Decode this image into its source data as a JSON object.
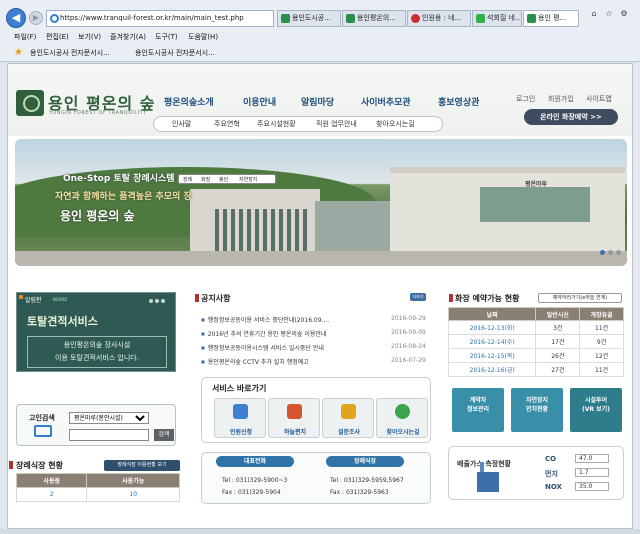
{
  "browser": {
    "address": "https://www.tranquil-forest.or.kr/main/main_test.php",
    "tabs": [
      "용인도시공...",
      "용인평온의...",
      "인원용 : 네...",
      "석회질 네..",
      "용인 평..."
    ],
    "active_tab_index": 4,
    "menu": [
      "파일(F)",
      "편집(E)",
      "보기(V)",
      "즐겨찾기(A)",
      "도구(T)",
      "도움말(H)"
    ],
    "favorites": [
      "용인도시공사 전자문서시...",
      "용인도시공사 전자문서시..."
    ]
  },
  "site": {
    "logo_title": "용인 평온의 숲",
    "logo_sub": "YONGIN FOREST OF TRANQUILITY",
    "nav": [
      "평온의숲소개",
      "이용안내",
      "알림마당",
      "사이버추모관",
      "홍보영상관"
    ],
    "util_links": [
      "로그인",
      "회원가입",
      "사이트맵"
    ],
    "reserve_button": "온라인 화장예약 >>",
    "subnav": [
      "인사말",
      "주요연혁",
      "주요시설현황",
      "직원 업무안내",
      "찾아오시는길"
    ]
  },
  "hero": {
    "line1": "One-Stop 토탈 장례시스템",
    "line2": "자연과 함께하는 품격높은 추모의 장",
    "line3": "용인 평온의 숲",
    "tags": [
      "장례",
      "화장",
      "봉안",
      "자연장지"
    ],
    "building_sign": "평온마루"
  },
  "notice": {
    "title": "알림판",
    "badge": "BOARD",
    "headline": "토탈견적서비스",
    "body_line1": "용인평온의숲 장사시설",
    "body_line2": "이용 토탈견적서비스 입니다."
  },
  "search": {
    "label": "고인검색",
    "select_value": "평온마루(봉안시설)",
    "button": "검색"
  },
  "dining": {
    "title": "장례식장 현황",
    "button": "장례식장 이용현황 보기",
    "headers": [
      "사용중",
      "사용가능"
    ],
    "values": [
      "2",
      "10"
    ]
  },
  "news": {
    "title": "공지사항",
    "more": "더보기",
    "items": [
      {
        "text": "행정정보공동이용 서비스 중단안내(2016.09....",
        "date": "2016-09-29"
      },
      {
        "text": "2016년 추석 연휴기간 용인 평온의숲 이용안내",
        "date": "2016-09-09"
      },
      {
        "text": "행정정보공동이용시스템 서비스 일시중단 안내",
        "date": "2016-08-24"
      },
      {
        "text": "용인평온의숲 CCTV 추가 설치 행정예고",
        "date": "2016-07-29"
      }
    ]
  },
  "services": {
    "title": "서비스 바로가기",
    "items": [
      "민원신청",
      "하늘편지",
      "설문조사",
      "찾아오시는길"
    ]
  },
  "contact": {
    "rep_label": "대표전화",
    "rep_tel": "Tel : 031)329-5900~3",
    "rep_fax": "Fax : 031)329-5904",
    "fun_label": "장례식장",
    "fun_tel": "Tel : 031)329-5959,5967",
    "fun_fax": "Fax : 031)329-5963"
  },
  "reservation": {
    "title": "화장 예약가능 현황",
    "button": "예약하러가기(e하늘 연계)",
    "headers": [
      "날짜",
      "일반시신",
      "개장유골"
    ],
    "rows": [
      [
        "2016-12-13(화)",
        "3건",
        "11건"
      ],
      [
        "2016-12-14(수)",
        "17건",
        "9건"
      ],
      [
        "2016-12-15(목)",
        "26건",
        "12건"
      ],
      [
        "2016-12-16(금)",
        "27건",
        "11건"
      ]
    ]
  },
  "quick": [
    {
      "l1": "계약자",
      "l2": "정보관리"
    },
    {
      "l1": "자연장지",
      "l2": "안치현황"
    },
    {
      "l1": "시설투어",
      "l2": "(VR 보기)"
    }
  ],
  "emission": {
    "title": "배출가스 측정현황",
    "rows": [
      {
        "name": "CO",
        "value": "47.0"
      },
      {
        "name": "먼지",
        "value": "1.7"
      },
      {
        "name": "NOX",
        "value": "35.0"
      }
    ]
  },
  "colors": {
    "brand_green": "#2f5f3c",
    "nav_blue": "#1f4d7b",
    "accent_red": "#b23232",
    "table_header": "#8a7f73"
  }
}
